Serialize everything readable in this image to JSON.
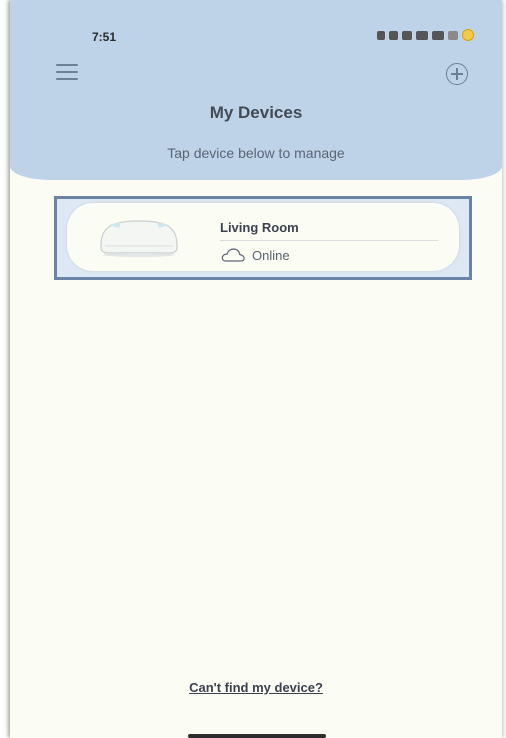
{
  "status_bar": {
    "time": "7:51"
  },
  "header": {
    "title": "My Devices",
    "subtitle": "Tap device below to manage"
  },
  "devices": [
    {
      "name": "Living Room",
      "status": "Online",
      "status_icon": "cloud-icon"
    }
  ],
  "footer": {
    "help_link": "Can't find my device?"
  },
  "icons": {
    "menu": "menu-icon",
    "add": "add-circle-icon"
  },
  "colors": {
    "header_bg": "#bed3e8",
    "page_bg": "#fbfcf4",
    "highlight_border": "#6a84a6"
  }
}
